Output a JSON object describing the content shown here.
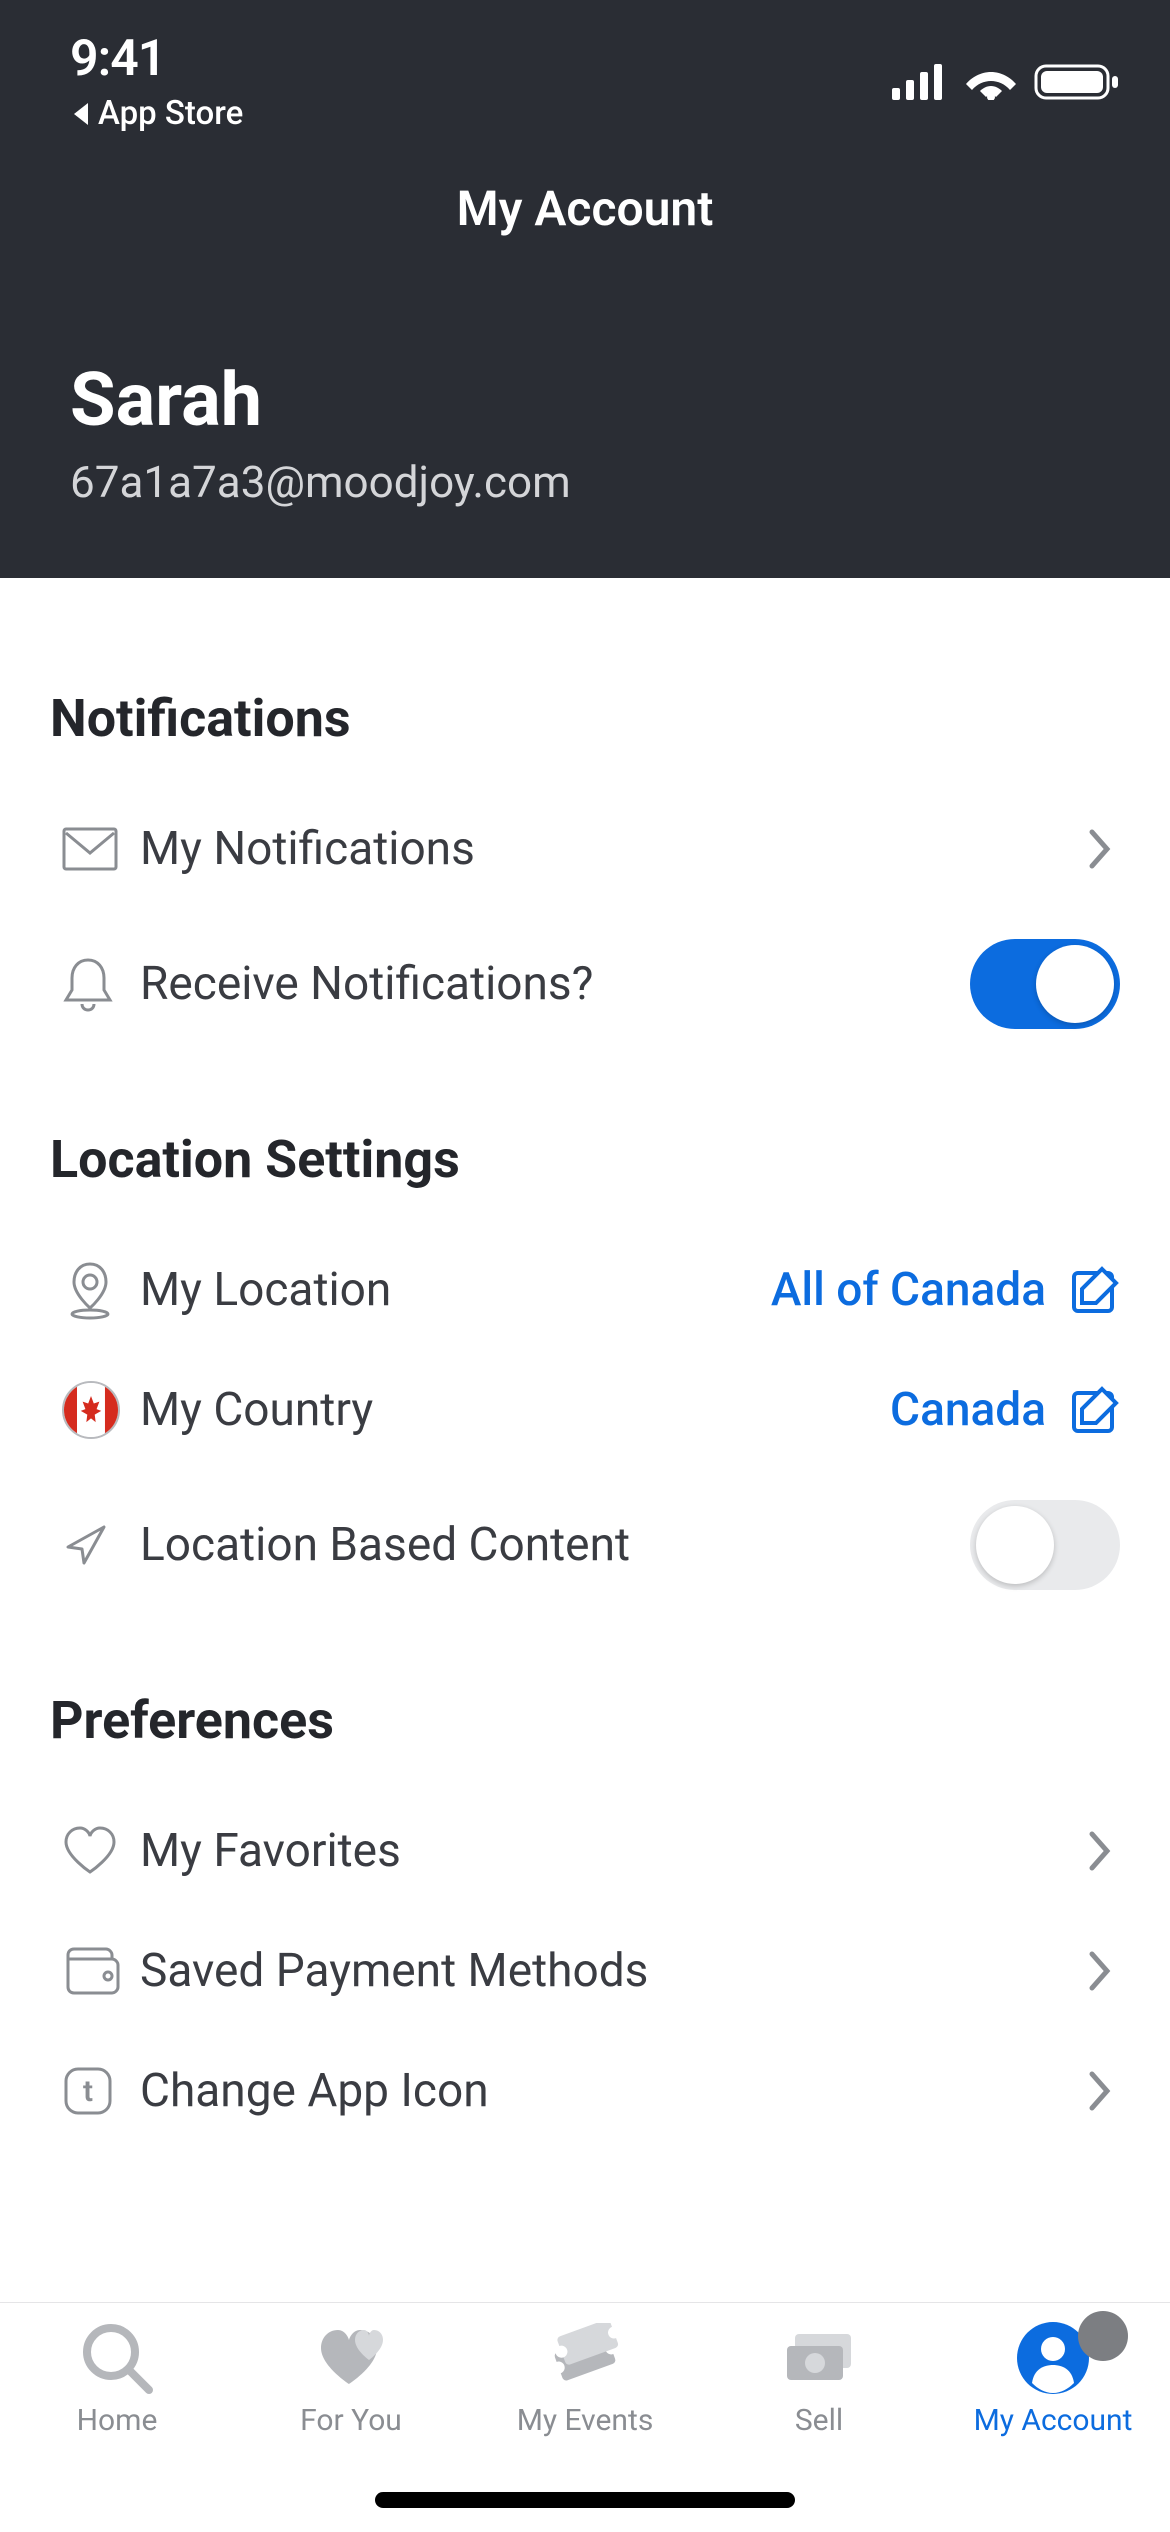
{
  "status": {
    "time": "9:41",
    "back_label": "App Store"
  },
  "header": {
    "title": "My Account"
  },
  "user": {
    "name": "Sarah",
    "email": "67a1a7a3@moodjoy.com"
  },
  "sections": {
    "notifications": {
      "title": "Notifications",
      "my_notifications": "My Notifications",
      "receive": "Receive Notifications?",
      "receive_on": true
    },
    "location": {
      "title": "Location Settings",
      "my_location_label": "My Location",
      "my_location_value": "All of Canada",
      "my_country_label": "My Country",
      "my_country_value": "Canada",
      "location_based_label": "Location Based Content",
      "location_based_on": false
    },
    "preferences": {
      "title": "Preferences",
      "favorites": "My Favorites",
      "payment": "Saved Payment Methods",
      "app_icon": "Change App Icon"
    }
  },
  "tabbar": {
    "home": "Home",
    "for_you": "For You",
    "my_events": "My Events",
    "sell": "Sell",
    "my_account": "My Account"
  },
  "colors": {
    "accent": "#0c6cdf",
    "dark_bg": "#2a2d34",
    "inactive": "#8a8d92"
  }
}
